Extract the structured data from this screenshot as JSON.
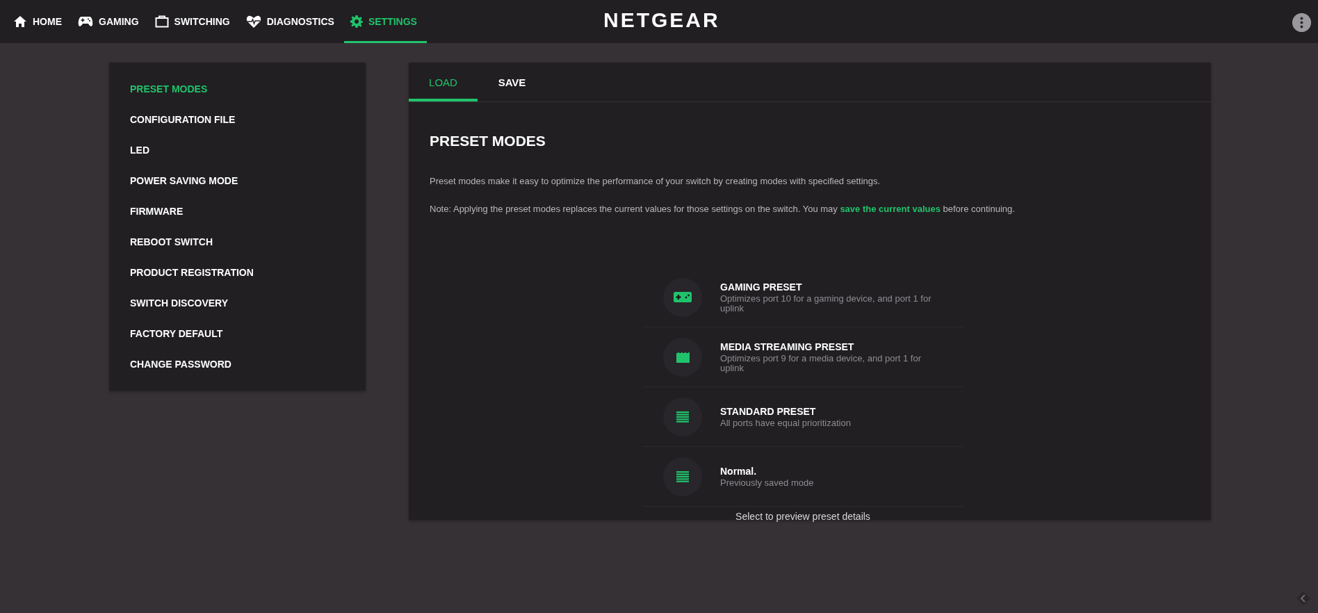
{
  "nav": {
    "tabs": [
      {
        "label": "HOME",
        "kind": "home",
        "selected": false
      },
      {
        "label": "GAMING",
        "kind": "gamepad",
        "selected": false
      },
      {
        "label": "SWITCHING",
        "kind": "case",
        "selected": false
      },
      {
        "label": "DIAGNOSTICS",
        "kind": "heart",
        "selected": false
      },
      {
        "label": "SETTINGS",
        "kind": "gear",
        "selected": true
      }
    ],
    "logo": "NETGEAR"
  },
  "sidebar": {
    "items": [
      {
        "label": "PRESET MODES",
        "selected": true
      },
      {
        "label": "CONFIGURATION FILE",
        "selected": false
      },
      {
        "label": "LED",
        "selected": false
      },
      {
        "label": "POWER SAVING MODE",
        "selected": false
      },
      {
        "label": "FIRMWARE",
        "selected": false
      },
      {
        "label": "REBOOT SWITCH",
        "selected": false
      },
      {
        "label": "PRODUCT REGISTRATION",
        "selected": false
      },
      {
        "label": "SWITCH DISCOVERY",
        "selected": false
      },
      {
        "label": "FACTORY DEFAULT",
        "selected": false
      },
      {
        "label": "CHANGE PASSWORD",
        "selected": false
      }
    ]
  },
  "panel": {
    "tabs": [
      {
        "label": "LOAD",
        "selected": true
      },
      {
        "label": "SAVE",
        "selected": false
      }
    ],
    "heading": "PRESET MODES",
    "intro": "Preset modes make it easy to optimize the performance of your switch by creating modes with specified settings.",
    "note": "Note: Applying the preset modes replaces the current values for those settings on the switch. You may ",
    "note_link": "save the current values",
    "note_end": " before continuing.",
    "presets": [
      {
        "kind": "gamepad",
        "title": "GAMING PRESET",
        "description": "Optimizes port 10 for a gaming device, and port 1 for uplink"
      },
      {
        "kind": "clapper",
        "title": "MEDIA STREAMING PRESET",
        "description": "Optimizes port 9 for a media device, and port 1 for uplink"
      },
      {
        "kind": "list",
        "title": "STANDARD PRESET",
        "description": "All ports have equal prioritization"
      },
      {
        "kind": "list",
        "title": "Normal.",
        "description": "Previously saved mode"
      }
    ],
    "hint": "Select to preview preset details"
  }
}
